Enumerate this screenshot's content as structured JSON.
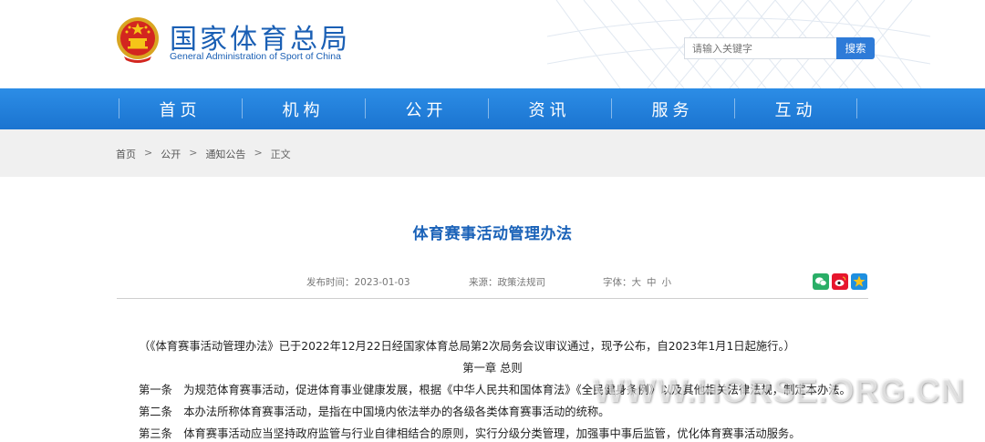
{
  "header": {
    "site_name_cn": "国家体育总局",
    "site_name_en": "General Administration of Sport of China",
    "search_placeholder": "请输入关键字",
    "search_button": "搜索"
  },
  "nav": {
    "items": [
      "首页",
      "机构",
      "公开",
      "资讯",
      "服务",
      "互动"
    ]
  },
  "breadcrumb": {
    "items": [
      "首页",
      "公开",
      "通知公告",
      "正文"
    ],
    "separator": ">"
  },
  "article": {
    "title": "体育赛事活动管理办法",
    "publish_label": "发布时间：2023-01-03",
    "source_label": "来源：政策法规司",
    "font_label": "字体：",
    "font_sizes": [
      "大",
      "中",
      "小"
    ],
    "share_icons": [
      "wechat-icon",
      "weibo-icon",
      "qzone-icon"
    ],
    "paragraphs": {
      "intro": "（《体育赛事活动管理办法》已于2022年12月22日经国家体育总局第2次局务会议审议通过，现予公布，自2023年1月1日起施行。）",
      "chapter": "第一章 总则",
      "art1": "第一条　为规范体育赛事活动，促进体育事业健康发展，根据《中华人民共和国体育法》《全民健身条例》以及其他相关法律法规，制定本办法。",
      "art2": "第二条　本办法所称体育赛事活动，是指在中国境内依法举办的各级各类体育赛事活动的统称。",
      "art3": "第三条　体育赛事活动应当坚持政府监管与行业自律相结合的原则，实行分级分类管理，加强事中事后监管，优化体育赛事活动服务。"
    }
  },
  "watermark": "WWW.HORSE.ORG.CN",
  "colors": {
    "brand_blue": "#1a5fb4",
    "nav_blue": "#1b74d0",
    "title_blue": "#1a62b8",
    "search_blue": "#2e7bd8"
  }
}
